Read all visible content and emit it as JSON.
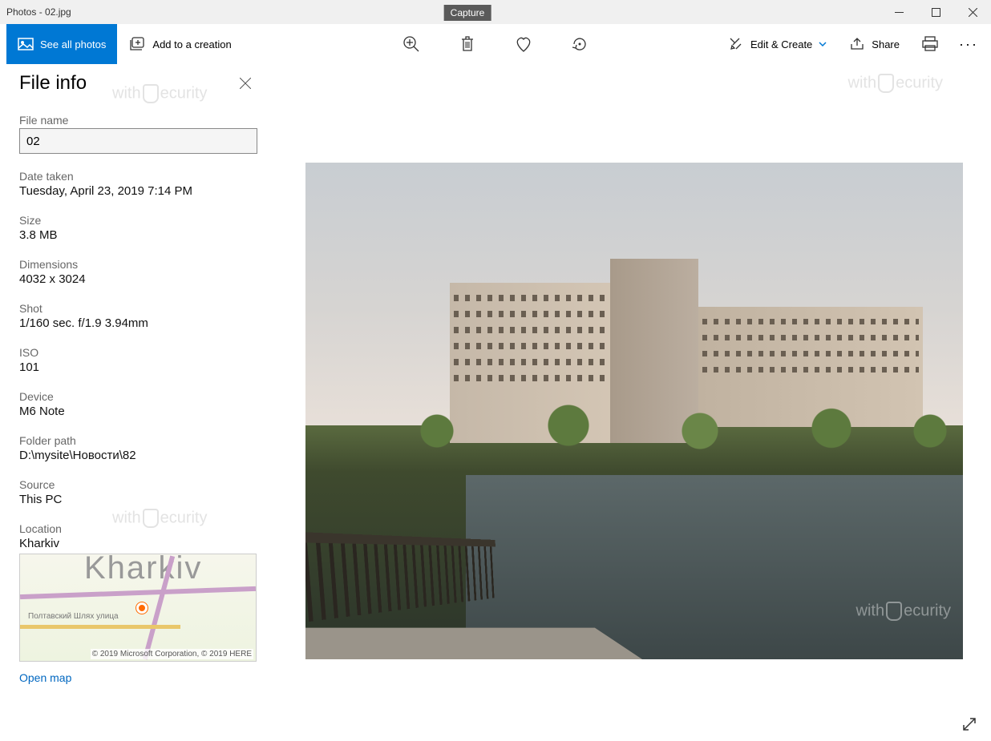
{
  "titlebar": {
    "title": "Photos - 02.jpg"
  },
  "toolbar": {
    "see_all": "See all photos",
    "add_creation": "Add to a creation",
    "tooltip_delete": "Capture",
    "edit_create": "Edit & Create",
    "share": "Share"
  },
  "sidebar": {
    "title": "File info",
    "filename_label": "File name",
    "filename_value": "02",
    "date_label": "Date taken",
    "date_value": "Tuesday, April 23, 2019 7:14 PM",
    "size_label": "Size",
    "size_value": "3.8 MB",
    "dimensions_label": "Dimensions",
    "dimensions_value": "4032 x 3024",
    "shot_label": "Shot",
    "shot_value": "1/160 sec. f/1.9 3.94mm",
    "iso_label": "ISO",
    "iso_value": "101",
    "device_label": "Device",
    "device_value": "M6 Note",
    "folder_label": "Folder path",
    "folder_value": "D:\\mysite\\Новости\\82",
    "source_label": "Source",
    "source_value": "This PC",
    "location_label": "Location",
    "location_value": "Kharkiv",
    "map_city": "Kharkiv",
    "map_street": "Полтавский Шлях улица",
    "map_credit": "© 2019 Microsoft Corporation, © 2019 HERE",
    "open_map": "Open map"
  },
  "watermark": {
    "pre": "with",
    "post": "ecurity"
  }
}
